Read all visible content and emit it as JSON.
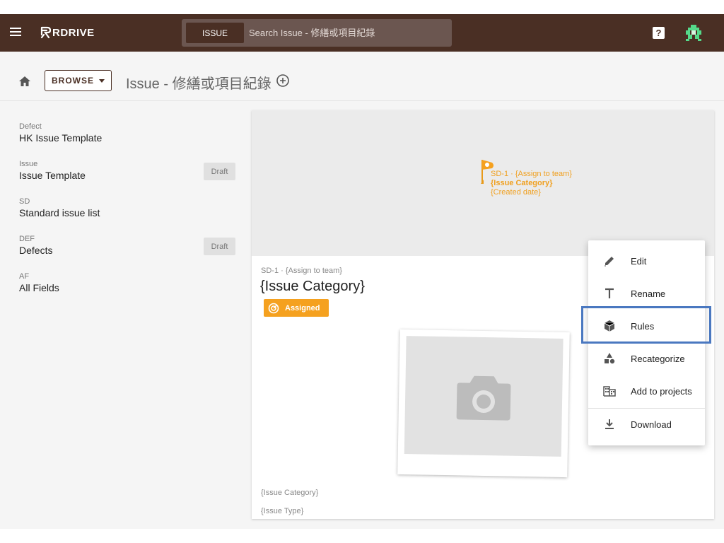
{
  "app": {
    "logo_text": "RDRIVE"
  },
  "search": {
    "tab_label": "ISSUE",
    "placeholder": "Search Issue - 修繕或項目紀錄"
  },
  "header": {
    "help_label": "?"
  },
  "toolbar": {
    "browse_label": "BROWSE",
    "page_title": "Issue - 修繕或項目紀錄"
  },
  "templates": [
    {
      "code": "Defect",
      "name": "HK Issue Template",
      "badge": ""
    },
    {
      "code": "Issue",
      "name": "Issue Template",
      "badge": "Draft"
    },
    {
      "code": "SD",
      "name": "Standard issue list",
      "badge": ""
    },
    {
      "code": "DEF",
      "name": "Defects",
      "badge": "Draft"
    },
    {
      "code": "AF",
      "name": "All Fields",
      "badge": ""
    }
  ],
  "card": {
    "pin_line1": "SD-1 · {Assign to team}",
    "pin_line2": "{Issue Category}",
    "pin_line3": "{Created date}",
    "subtitle": "SD-1 · {Assign to team}",
    "title": "{Issue Category}",
    "status": "Assigned",
    "footer_line1": "{Issue Category}",
    "footer_line2": "{Issue Type}"
  },
  "context_menu": {
    "items": [
      {
        "label": "Edit",
        "icon": "pencil-icon"
      },
      {
        "label": "Rename",
        "icon": "text-icon"
      },
      {
        "label": "Rules",
        "icon": "cube-icon"
      },
      {
        "label": "Recategorize",
        "icon": "shapes-icon"
      },
      {
        "label": "Add to projects",
        "icon": "building-icon"
      },
      {
        "label": "Download",
        "icon": "download-icon"
      }
    ]
  },
  "colors": {
    "appbar": "#4a2f24",
    "accent_orange": "#f5a11f",
    "highlight_blue": "#4a78c0"
  }
}
